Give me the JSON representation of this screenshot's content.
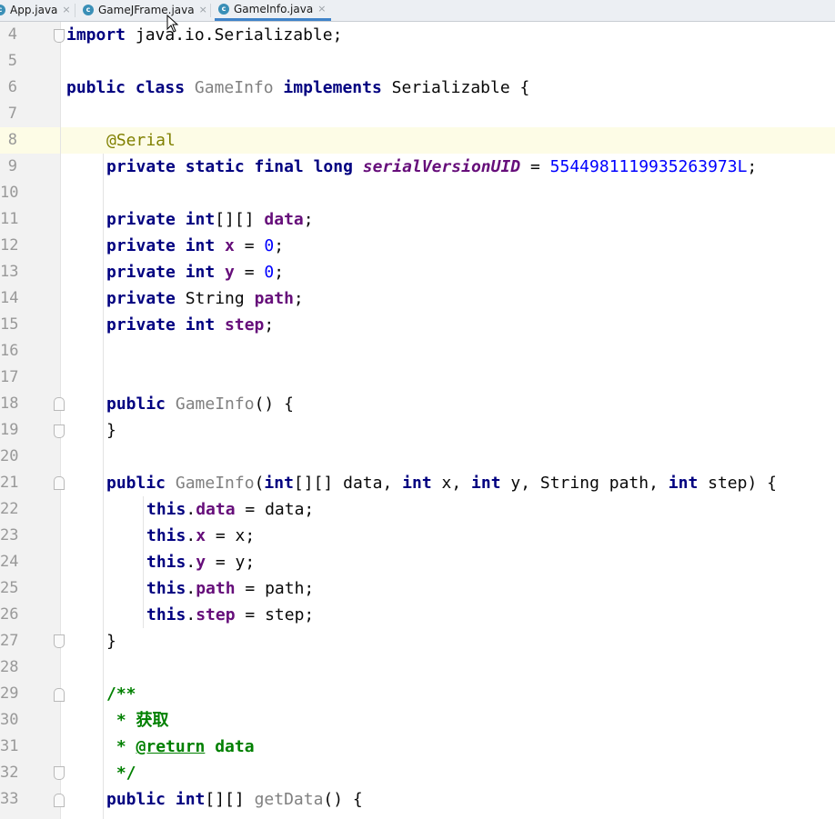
{
  "tabs": [
    {
      "label": "App.java",
      "active": false
    },
    {
      "label": "GameJFrame.java",
      "active": false
    },
    {
      "label": "GameInfo.java",
      "active": true
    }
  ],
  "tab_close_glyph": "×",
  "tab_icon_letter": "c",
  "line_numbers": [
    "4",
    "5",
    "6",
    "7",
    "8",
    "9",
    "10",
    "11",
    "12",
    "13",
    "14",
    "15",
    "16",
    "17",
    "18",
    "19",
    "20",
    "21",
    "22",
    "23",
    "24",
    "25",
    "26",
    "27",
    "28",
    "29",
    "30",
    "31",
    "32",
    "33"
  ],
  "code": {
    "l4_a": "import",
    "l4_b": " java.io.Serializable;",
    "l6_public": "public",
    "l6_class": " class ",
    "l6_name": "GameInfo",
    "l6_impl": " implements",
    "l6_rest": " Serializable {",
    "l8": "@Serial",
    "l9_kw": "private static final long ",
    "l9_field": "serialVersionUID",
    "l9_eq": " = ",
    "l9_val": "5544981119935263973L",
    "l9_end": ";",
    "l11_kw": "private int",
    "l11_mid": "[][] ",
    "l11_f": "data",
    "l11_end": ";",
    "l12_kw": "private int ",
    "l12_f": "x",
    "l12_eq": " = ",
    "l12_v": "0",
    "l12_end": ";",
    "l13_kw": "private int ",
    "l13_f": "y",
    "l13_eq": " = ",
    "l13_v": "0",
    "l13_end": ";",
    "l14_kw": "private",
    "l14_mid": " String ",
    "l14_f": "path",
    "l14_end": ";",
    "l15_kw": "private int ",
    "l15_f": "step",
    "l15_end": ";",
    "l18_kw": "public ",
    "l18_name": "GameInfo",
    "l18_end": "() {",
    "l19": "}",
    "l21_kw": "public ",
    "l21_name": "GameInfo",
    "l21_p1": "(",
    "l21_int1": "int",
    "l21_p2": "[][] data, ",
    "l21_int2": "int",
    "l21_p3": " x, ",
    "l21_int3": "int",
    "l21_p4": " y, String path, ",
    "l21_int4": "int",
    "l21_p5": " step) {",
    "l22_this": "this",
    "l22_dot": ".",
    "l22_f": "data",
    "l22_rest": " = data;",
    "l23_this": "this",
    "l23_dot": ".",
    "l23_f": "x",
    "l23_rest": " = x;",
    "l24_this": "this",
    "l24_dot": ".",
    "l24_f": "y",
    "l24_rest": " = y;",
    "l25_this": "this",
    "l25_dot": ".",
    "l25_f": "path",
    "l25_rest": " = path;",
    "l26_this": "this",
    "l26_dot": ".",
    "l26_f": "step",
    "l26_rest": " = step;",
    "l27": "}",
    "l29": "/**",
    "l30": " * 获取",
    "l31_a": " * ",
    "l31_tag": "@return",
    "l31_b": " data",
    "l32": " */",
    "l33_kw": "public int",
    "l33_mid": "[][] ",
    "l33_name": "getData",
    "l33_end": "() {"
  },
  "colors": {
    "keyword": "#000080",
    "field": "#660e7a",
    "number": "#0000ff",
    "annotation": "#808000",
    "comment": "#008000",
    "highlight_line": "#fdfce6"
  }
}
